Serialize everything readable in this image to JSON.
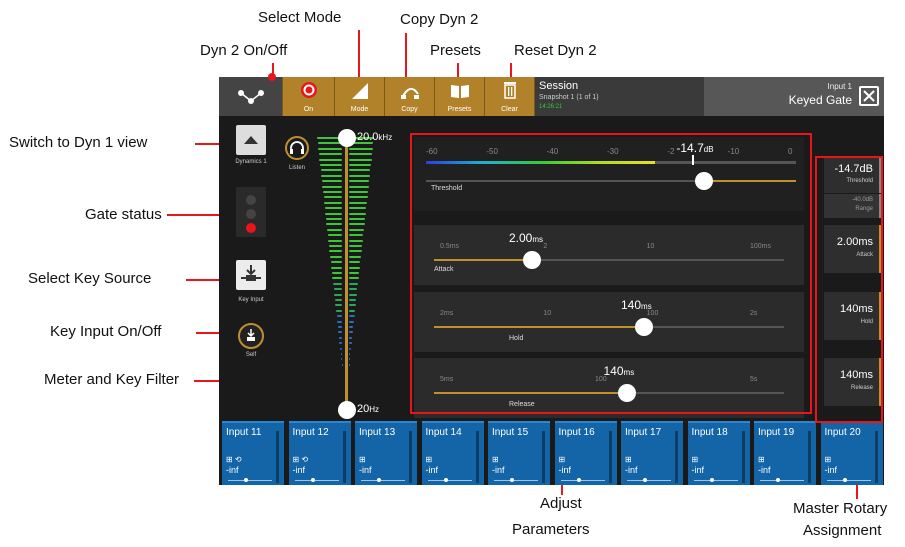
{
  "annotations": {
    "select_mode": "Select Mode",
    "copy_dyn2": "Copy Dyn 2",
    "dyn2_onoff": "Dyn 2 On/Off",
    "presets": "Presets",
    "reset_dyn2": "Reset Dyn 2",
    "switch_dyn1": "Switch to Dyn 1 view",
    "gate_status": "Gate status",
    "select_key": "Select Key Source",
    "key_input_onoff": "Key Input On/Off",
    "meter_filter": "Meter and Key Filter",
    "adjust_params_1": "Adjust",
    "adjust_params_2": "Parameters",
    "master_rotary_1": "Master Rotary",
    "master_rotary_2": "Assignment"
  },
  "toolbar": {
    "on": "On",
    "mode": "Mode",
    "copy": "Copy",
    "presets": "Presets",
    "clear": "Clear"
  },
  "session": {
    "title": "Session",
    "snapshot": "Snapshot 1 (1 of 1)",
    "status": "14:26:21"
  },
  "channel": {
    "name": "Input 1",
    "processor": "Keyed Gate"
  },
  "left": {
    "dynamics": "Dynamics 1",
    "listen": "Listen",
    "key_input": "Key Input",
    "self": "Self"
  },
  "filter": {
    "hi": "20.0",
    "hi_unit": "kHz",
    "lo": "20",
    "lo_unit": "Hz",
    "hi_frac": 1.0,
    "lo_frac": 0.0
  },
  "threshold": {
    "scale": [
      "-60",
      "-50",
      "-40",
      "-30",
      "-20",
      "-10",
      "0"
    ],
    "value": "-14.7",
    "unit": "dB",
    "label": "Threshold",
    "frac": 0.75
  },
  "attack": {
    "value": "2.00",
    "unit": "ms",
    "label": "Attack",
    "ticks": [
      "0.5ms",
      "2",
      "10",
      "100ms"
    ],
    "frac": 0.28
  },
  "hold": {
    "value": "140",
    "unit": "ms",
    "label": "Hold",
    "ticks": [
      "2ms",
      "10",
      "100",
      "2s"
    ],
    "frac": 0.6
  },
  "release": {
    "value": "140",
    "unit": "ms",
    "label": "Release",
    "ticks": [
      "5ms",
      "100",
      "5s"
    ],
    "frac": 0.55
  },
  "rotaries": [
    {
      "value": "-14.7dB",
      "name": "Threshold"
    },
    {
      "value": "2.00ms",
      "name": "Attack"
    },
    {
      "value": "140ms",
      "name": "Hold"
    },
    {
      "value": "140ms",
      "name": "Release"
    }
  ],
  "range": {
    "value": "-40.0dB",
    "name": "Range"
  },
  "strips": [
    {
      "name": "Input 11",
      "level": "-inf",
      "icons": "⊞ ⟲"
    },
    {
      "name": "Input 12",
      "level": "-inf",
      "icons": "⊞ ⟲"
    },
    {
      "name": "Input 13",
      "level": "-inf",
      "icons": "⊞"
    },
    {
      "name": "Input 14",
      "level": "-inf",
      "icons": "⊞"
    },
    {
      "name": "Input 15",
      "level": "-inf",
      "icons": "⊞"
    },
    {
      "name": "Input 16",
      "level": "-inf",
      "icons": "⊞"
    },
    {
      "name": "Input 17",
      "level": "-inf",
      "icons": "⊞"
    },
    {
      "name": "Input 18",
      "level": "-inf",
      "icons": "⊞"
    },
    {
      "name": "Input 19",
      "level": "-inf",
      "icons": "⊞"
    },
    {
      "name": "Input 20",
      "level": "-inf",
      "icons": "⊞"
    }
  ],
  "colors": {
    "accent": "#c0902e",
    "annotation": "#e8151b",
    "strip": "#1464a8"
  }
}
